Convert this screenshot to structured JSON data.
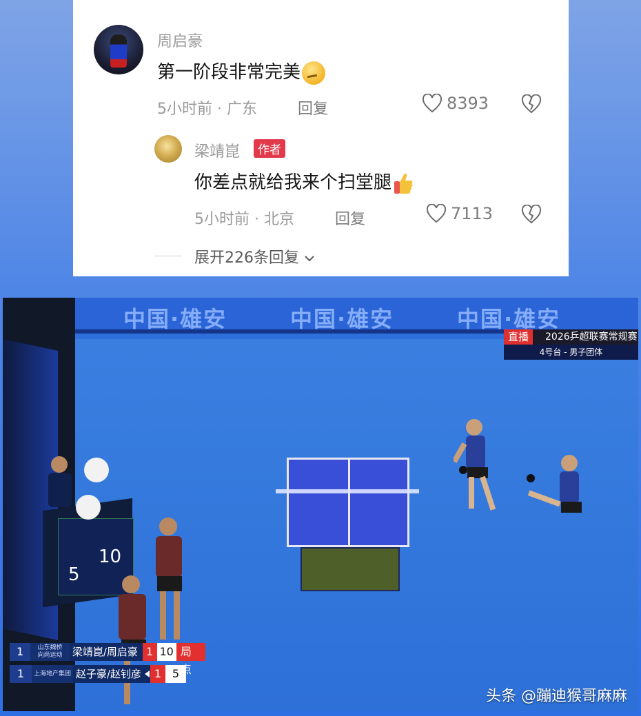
{
  "comment": {
    "username": "周启豪",
    "text": "第一阶段非常完美",
    "emoji": "thinking-face",
    "time": "5小时前",
    "location": "广东",
    "separator": "·",
    "reply_label": "回复",
    "likes": "8393"
  },
  "reply": {
    "username": "梁靖崑",
    "badge": "作者",
    "text": "你差点就给我来个扫堂腿",
    "emoji": "thumbs-up",
    "time": "5小时前",
    "location": "北京",
    "separator": "·",
    "reply_label": "回复",
    "likes": "7113"
  },
  "expand_label": "展开226条回复",
  "video": {
    "banner": [
      "中国·雄安",
      "中国·雄安",
      "中国·雄安"
    ],
    "live_tag": "直播",
    "live_title": "2026乒超联赛常规赛",
    "live_sub": "4号台 - 男子团体",
    "scoreboard": {
      "left": "5",
      "right": "10"
    },
    "score": [
      {
        "seed": "1",
        "team": [
          "山东魏桥",
          "向尚运动"
        ],
        "players": "梁靖崑/周启豪",
        "games": "1",
        "points": "10",
        "flag": "局点"
      },
      {
        "seed": "1",
        "team": [
          "上海地产集团"
        ],
        "players": "赵子豪/赵钊彦",
        "games": "1",
        "points": "5"
      }
    ]
  },
  "watermark": "头条 @蹦迪猴哥麻麻",
  "colors": {
    "accent_red": "#e23a4a",
    "court_blue": "#2f6fd9"
  }
}
